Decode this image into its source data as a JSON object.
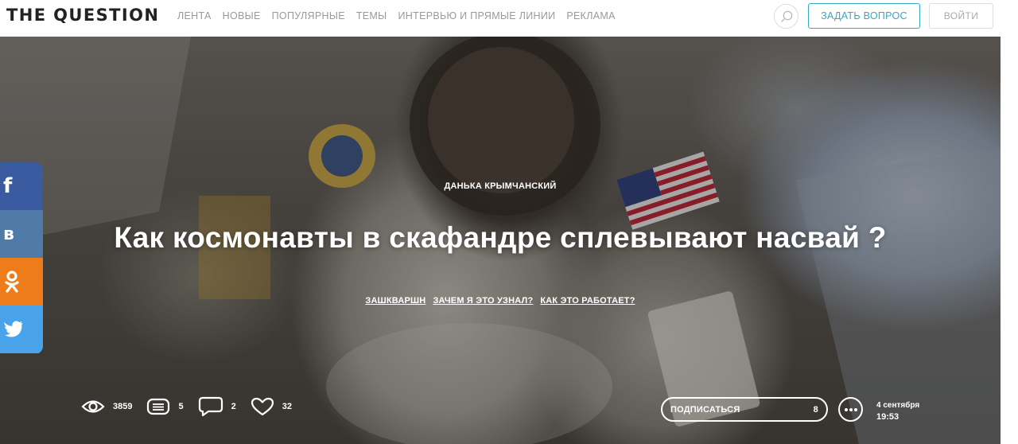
{
  "header": {
    "logo": "THE QUESTION",
    "nav": [
      "ЛЕНТА",
      "НОВЫЕ",
      "ПОПУЛЯРНЫЕ",
      "ТЕМЫ",
      "ИНТЕРВЬЮ И ПРЯМЫЕ ЛИНИИ",
      "РЕКЛАМА"
    ],
    "search_icon": "search-icon",
    "ask_button": "ЗАДАТЬ ВОПРОС",
    "login_button": "ВОЙТИ",
    "accent_color": "#35a9c4"
  },
  "question": {
    "author": "ДАНЬКА КРЫМЧАНСКИЙ",
    "title": "Как космонавты в скафандре сплевывают насвай ?",
    "tags": [
      "ЗАШКВАРШН",
      "ЗАЧЕМ Я ЭТО УЗНАЛ?",
      "КАК ЭТО РАБОТАЕТ?"
    ]
  },
  "social": [
    {
      "icon": "facebook-icon",
      "glyph": "f",
      "color": "#3b5ba0"
    },
    {
      "icon": "vk-icon",
      "glyph": "в",
      "color": "#507ba8"
    },
    {
      "icon": "odnoklassniki-icon",
      "glyph": "ок",
      "color": "#ee7c1a"
    },
    {
      "icon": "twitter-icon",
      "glyph": "t",
      "color": "#48a3ea"
    }
  ],
  "stats": {
    "views": "3859",
    "answers": "5",
    "comments": "2",
    "likes": "32"
  },
  "subscribe": {
    "label": "ПОДПИСАТЬСЯ",
    "count": "8"
  },
  "date": {
    "day": "4 сентября",
    "time": "19:53"
  }
}
